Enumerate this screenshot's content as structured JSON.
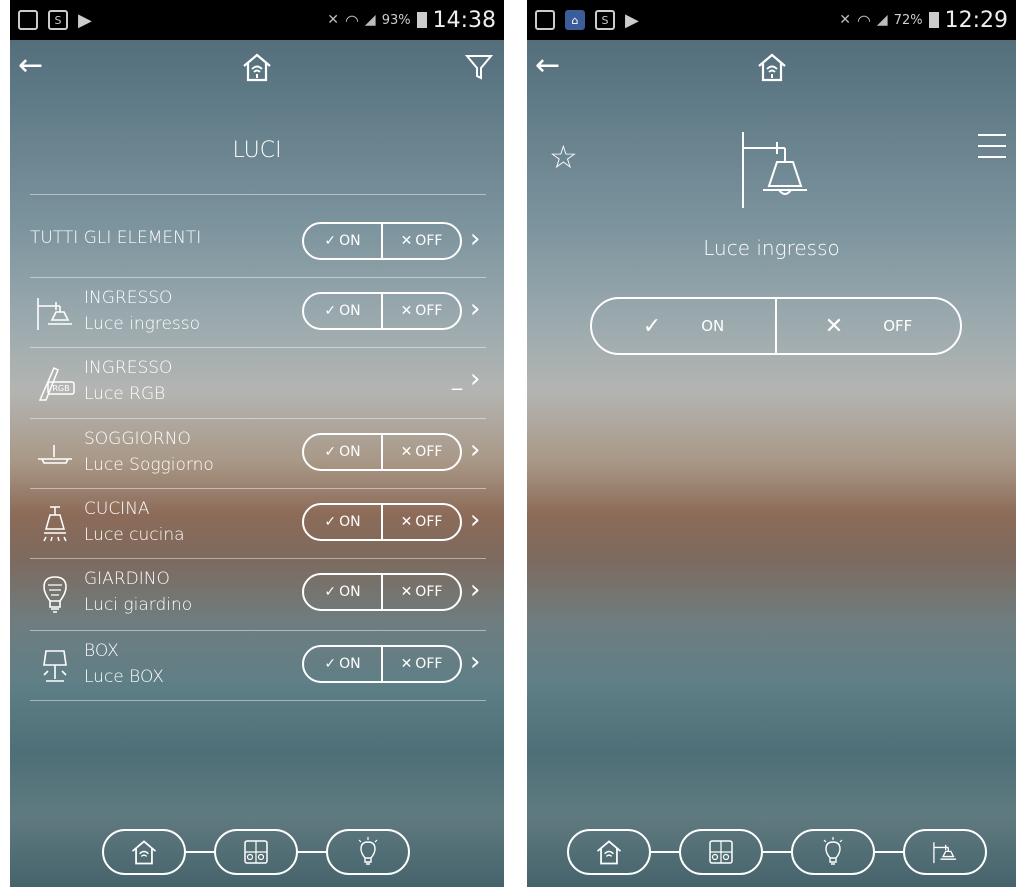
{
  "left_screen": {
    "status": {
      "battery": "93%",
      "time": "14:38"
    },
    "title": "LUCI",
    "all_row": {
      "label": "TUTTI GLI ELEMENTI",
      "on": "ON",
      "off": "OFF"
    },
    "rows": [
      {
        "room": "INGRESSO",
        "name": "Luce ingresso",
        "icon": "wall-lamp-icon",
        "on": "ON",
        "off": "OFF"
      },
      {
        "room": "INGRESSO",
        "name": "Luce RGB",
        "icon": "rgb-brush-icon",
        "value": "_"
      },
      {
        "room": "SOGGIORNO",
        "name": "Luce Soggiorno",
        "icon": "ceiling-light-icon",
        "on": "ON",
        "off": "OFF"
      },
      {
        "room": "CUCINA",
        "name": "Luce cucina",
        "icon": "pendant-lamp-icon",
        "on": "ON",
        "off": "OFF"
      },
      {
        "room": "GIARDINO",
        "name": "Luci giardino",
        "icon": "bulb-icon",
        "on": "ON",
        "off": "OFF"
      },
      {
        "room": "BOX",
        "name": "Luce BOX",
        "icon": "table-lamp-icon",
        "on": "ON",
        "off": "OFF"
      }
    ]
  },
  "right_screen": {
    "status": {
      "battery": "72%",
      "time": "12:29"
    },
    "device_label": "Luce ingresso",
    "on": "ON",
    "off": "OFF"
  }
}
